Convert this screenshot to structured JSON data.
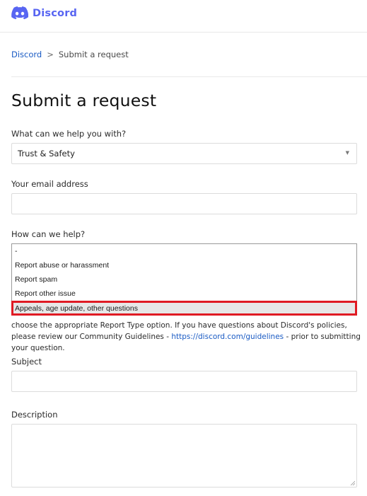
{
  "header": {
    "logo_text": "Discord",
    "brand_color": "#5865f2"
  },
  "breadcrumb": {
    "home": "Discord",
    "separator": ">",
    "current": "Submit a request"
  },
  "page": {
    "title": "Submit a request"
  },
  "form": {
    "topic_label": "What can we help you with?",
    "topic_value": "Trust & Safety",
    "email_label": "Your email address",
    "email_value": "",
    "help_label": "How can we help?",
    "help_options": [
      "-",
      "Report abuse or harassment",
      "Report spam",
      "Report other issue",
      "Appeals, age update, other questions"
    ],
    "help_selected": "Appeals, age update, other questions",
    "help_text_before": "choose the appropriate Report Type option. If you have questions about Discord's policies, please review our Community Guidelines - ",
    "help_text_link": "https://discord.com/guidelines",
    "help_text_after": " - prior to submitting your question.",
    "subject_label": "Subject",
    "subject_value": "",
    "description_label": "Description",
    "description_value": ""
  },
  "colors": {
    "link": "#1a5bc4",
    "highlight_border": "#e01b24"
  }
}
